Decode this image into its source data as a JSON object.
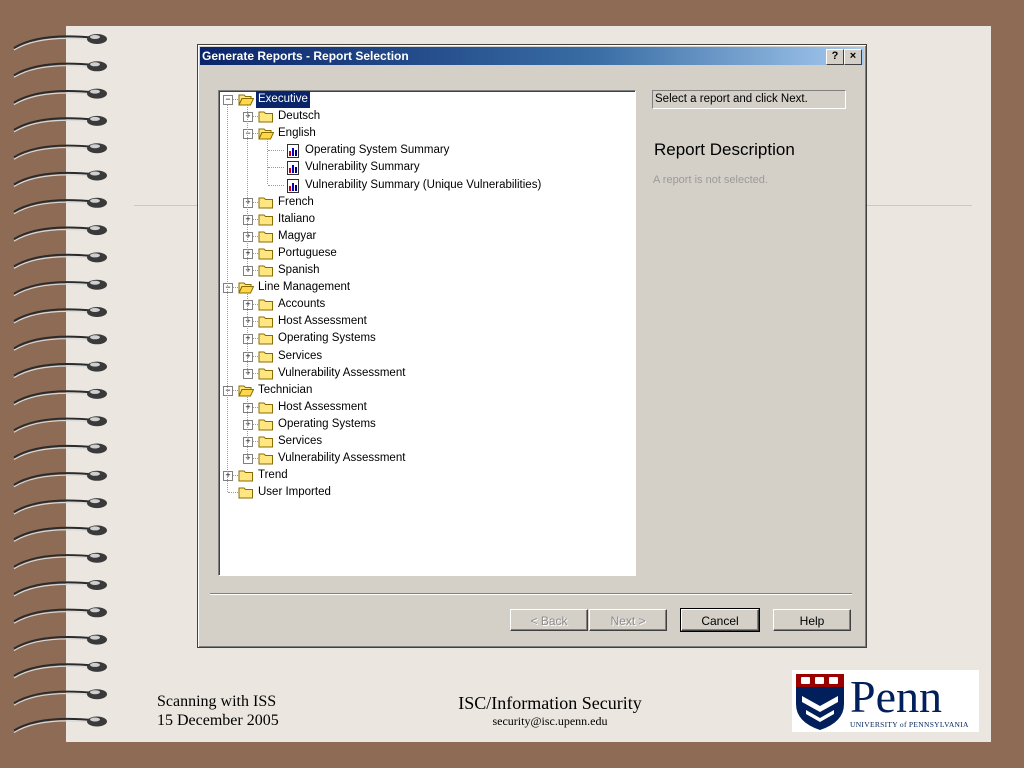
{
  "dialog": {
    "title": "Generate Reports - Report Selection",
    "help_btn": "?",
    "close_btn": "×",
    "hint": "Select a report and click Next.",
    "desc_title": "Report Description",
    "desc_text": "A report is not selected.",
    "buttons": {
      "back": "< Back",
      "next": "Next >",
      "cancel": "Cancel",
      "help": "Help"
    }
  },
  "tree": [
    {
      "label": "Executive",
      "level": 0,
      "type": "folder-open",
      "exp": "-",
      "sel": true
    },
    {
      "label": "Deutsch",
      "level": 1,
      "type": "folder",
      "exp": "+"
    },
    {
      "label": "English",
      "level": 1,
      "type": "folder-open",
      "exp": "-"
    },
    {
      "label": "Operating System Summary",
      "level": 2,
      "type": "report"
    },
    {
      "label": "Vulnerability Summary",
      "level": 2,
      "type": "report"
    },
    {
      "label": "Vulnerability Summary (Unique Vulnerabilities)",
      "level": 2,
      "type": "report"
    },
    {
      "label": "French",
      "level": 1,
      "type": "folder",
      "exp": "+"
    },
    {
      "label": "Italiano",
      "level": 1,
      "type": "folder",
      "exp": "+"
    },
    {
      "label": "Magyar",
      "level": 1,
      "type": "folder",
      "exp": "+"
    },
    {
      "label": "Portuguese",
      "level": 1,
      "type": "folder",
      "exp": "+"
    },
    {
      "label": "Spanish",
      "level": 1,
      "type": "folder",
      "exp": "+"
    },
    {
      "label": "Line Management",
      "level": 0,
      "type": "folder-open",
      "exp": "-"
    },
    {
      "label": "Accounts",
      "level": 1,
      "type": "folder",
      "exp": "+"
    },
    {
      "label": "Host Assessment",
      "level": 1,
      "type": "folder",
      "exp": "+"
    },
    {
      "label": "Operating Systems",
      "level": 1,
      "type": "folder",
      "exp": "+"
    },
    {
      "label": "Services",
      "level": 1,
      "type": "folder",
      "exp": "+"
    },
    {
      "label": "Vulnerability Assessment",
      "level": 1,
      "type": "folder",
      "exp": "+"
    },
    {
      "label": "Technician",
      "level": 0,
      "type": "folder-open",
      "exp": "-"
    },
    {
      "label": "Host Assessment",
      "level": 1,
      "type": "folder",
      "exp": "+"
    },
    {
      "label": "Operating Systems",
      "level": 1,
      "type": "folder",
      "exp": "+"
    },
    {
      "label": "Services",
      "level": 1,
      "type": "folder",
      "exp": "+"
    },
    {
      "label": "Vulnerability Assessment",
      "level": 1,
      "type": "folder",
      "exp": "+"
    },
    {
      "label": "Trend",
      "level": 0,
      "type": "folder",
      "exp": "+"
    },
    {
      "label": "User Imported",
      "level": 0,
      "type": "folder",
      "exp": ""
    }
  ],
  "footer": {
    "left_line1": "Scanning with ISS",
    "left_line2": "15 December 2005",
    "center_title": "ISC/Information Security",
    "center_email": "security@isc.upenn.edu"
  },
  "logo": {
    "name": "Penn",
    "subtitle": "UNIVERSITY of PENNSYLVANIA"
  },
  "colors": {
    "titlebar": "#0a246a",
    "selection": "#0a246a",
    "penn_blue": "#011f5b",
    "penn_red": "#990000",
    "background": "#8d6b55",
    "slide": "#ebe6df"
  }
}
